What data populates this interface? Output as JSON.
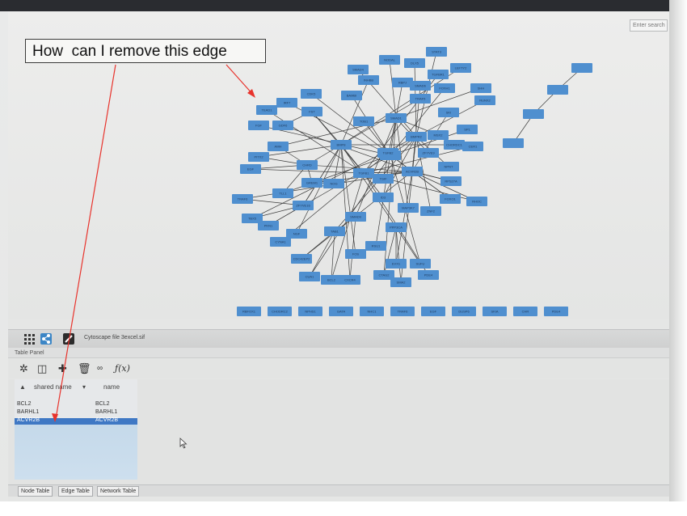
{
  "annotation": {
    "text": "How  can I remove this edge"
  },
  "search": {
    "placeholder": "Enter search"
  },
  "network": {
    "nodes": [
      "BMP8",
      "SMAD1",
      "BMPR2",
      "CHRD",
      "FGF",
      "ACVR2B",
      "ZFYVE16",
      "ZFYVE9",
      "SMAD5",
      "TGFB1",
      "TOB1",
      "TGFB2",
      "NOG",
      "TGIF",
      "NPNT",
      "GDF6",
      "BAMBI",
      "FST",
      "INHBB",
      "NODAL",
      "DLX5",
      "SMAD6",
      "FOXH1",
      "TGFBR1",
      "LEFTY2",
      "SHH",
      "RUNX2",
      "SKI",
      "SP1",
      "CER1",
      "CHORDC1",
      "MSX2",
      "ID3",
      "GREM1",
      "TLL1",
      "EGF",
      "PITX2",
      "AMH",
      "TBX5",
      "TRAF6",
      "PKN1",
      "CYNA1",
      "NGF",
      "SMAD9",
      "TAB1",
      "CDC42EP2",
      "CUA1",
      "BCL2",
      "CXCR4",
      "CTAG2",
      "SMA2",
      "EVX1",
      "SUFU",
      "PDE4",
      "PPP3CA",
      "MAP3K7",
      "ZNF2",
      "RPS27A",
      "FOXO1",
      "RHOC",
      "TRAF5",
      "RBPJ",
      "SMAD4",
      "CDK5",
      "IRF7",
      "TEAD1",
      "FOS",
      "RSU1",
      "STAT3"
    ],
    "isolated_nodes": [
      "RBFOX1",
      "CHODRC2",
      "NPHS1",
      "GATA",
      "NHC1",
      "TRAF6",
      "EGF",
      "DUSP6",
      "SKIA",
      "CHR",
      "PDE4"
    ]
  },
  "toolbar": {
    "file_label": "Cytoscape file 3excel.sif"
  },
  "table_panel": {
    "title": "Table Panel",
    "columns": [
      "shared name",
      "name"
    ],
    "rows": [
      {
        "shared_name": "BCL2",
        "name": "BCL2"
      },
      {
        "shared_name": "BARHL1",
        "name": "BARHL1"
      },
      {
        "shared_name": "ACVR2B",
        "name": "ACVR2B"
      }
    ],
    "selected_row": 2
  },
  "bottom_tabs": [
    "Node Table",
    "Edge Table",
    "Network Table"
  ],
  "colors": {
    "node": "#4f8fcf",
    "edge": "#3d3d3d",
    "annotation_arrow": "#e8332c",
    "selection": "#3f78c4"
  }
}
